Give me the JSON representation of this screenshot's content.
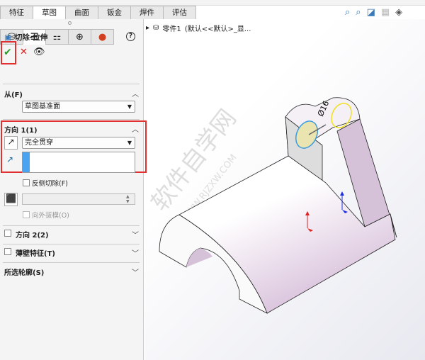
{
  "tabs": [
    "特征",
    "草图",
    "曲面",
    "钣金",
    "焊件",
    "评估"
  ],
  "active_tab": 1,
  "feature": {
    "title": "切除-拉伸",
    "help": "?",
    "ok": "✔",
    "cancel": "✕"
  },
  "from": {
    "label": "从(F)",
    "value": "草图基准面"
  },
  "direction1": {
    "label": "方向 1(1)",
    "end_condition": "完全贯穿",
    "flip_cut": "反侧切除(F)",
    "draft_outward": "向外拔模(O)",
    "depth": ""
  },
  "direction2": {
    "label": "方向 2(2)"
  },
  "thin": {
    "label": "薄壁特征(T)"
  },
  "contours": {
    "label": "所选轮廓(S)"
  },
  "tree": {
    "part": "零件1",
    "config": "(默认<<默认>_显..."
  },
  "model": {
    "dimension": "Ø16"
  },
  "watermark": {
    "cn": "软件自学网",
    "url": "WWW.RJZXW.COM"
  },
  "colors": {
    "accent_red": "#e03030",
    "face": "#d8c4dc",
    "ok": "#2a9a2a"
  }
}
